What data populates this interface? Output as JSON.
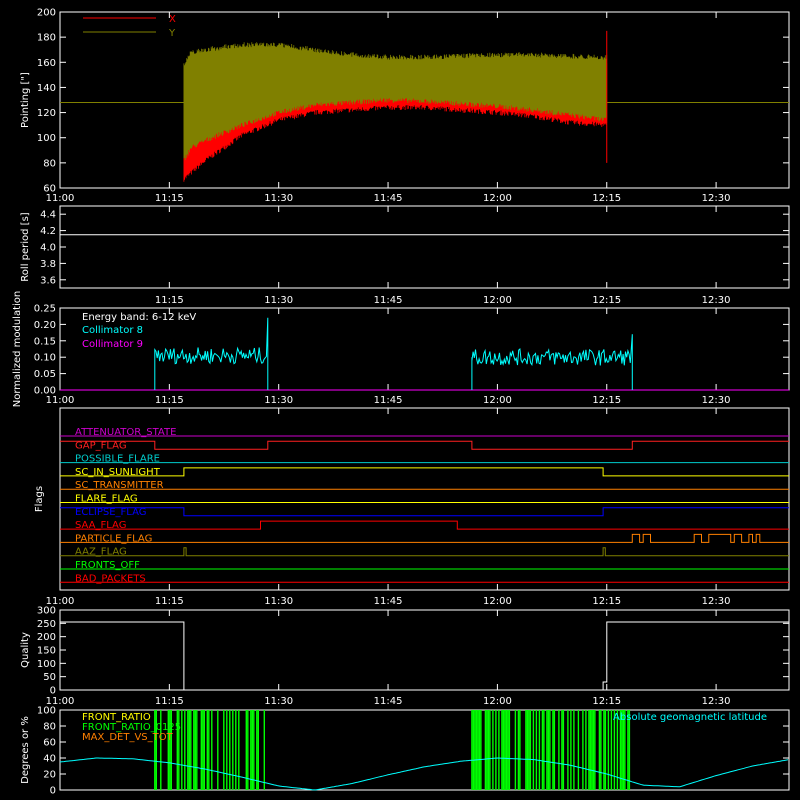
{
  "chart_data": [
    {
      "id": "pointing",
      "type": "line",
      "ylabel": "Pointing [\"]",
      "ylim": [
        60,
        200
      ],
      "yticks": [
        60,
        80,
        100,
        120,
        140,
        160,
        180,
        200
      ],
      "xticks": [
        "11:00",
        "11:15",
        "11:30",
        "11:45",
        "12:00",
        "12:15",
        "12:30"
      ],
      "x_range_minutes": [
        0,
        100
      ],
      "legend": [
        {
          "name": "X",
          "color": "#ff0000"
        },
        {
          "name": "Y",
          "color": "#808000"
        }
      ],
      "baseline_value": 128,
      "active_interval": [
        "11:17",
        "12:15"
      ],
      "series": [
        {
          "name": "X",
          "color": "#ff0000",
          "x": [
            17,
            18,
            20,
            25,
            30,
            35,
            40,
            45,
            50,
            55,
            60,
            65,
            70,
            75
          ],
          "low": [
            65,
            70,
            80,
            100,
            112,
            118,
            120,
            122,
            122,
            120,
            118,
            115,
            110,
            108
          ],
          "high": [
            145,
            150,
            155,
            160,
            160,
            158,
            158,
            160,
            162,
            164,
            164,
            164,
            163,
            162
          ]
        },
        {
          "name": "Y",
          "color": "#808000",
          "x": [
            17,
            18,
            20,
            25,
            30,
            35,
            40,
            45,
            50,
            55,
            60,
            65,
            70,
            75
          ],
          "low": [
            80,
            90,
            96,
            108,
            118,
            124,
            126,
            128,
            127,
            125,
            123,
            120,
            116,
            112
          ],
          "high": [
            160,
            170,
            172,
            176,
            176,
            172,
            168,
            166,
            166,
            167,
            168,
            168,
            167,
            166
          ]
        }
      ]
    },
    {
      "id": "roll",
      "type": "line",
      "ylabel": "Roll period [s]",
      "ylim": [
        3.5,
        4.5
      ],
      "yticks": [
        3.6,
        3.8,
        4.0,
        4.2,
        4.4
      ],
      "xticks": [
        "11:15",
        "11:30",
        "11:45",
        "12:00",
        "12:15",
        "12:30"
      ],
      "series": [
        {
          "name": "roll",
          "color": "#ffffff",
          "x": [
            0,
            100
          ],
          "values": [
            4.15,
            4.15
          ]
        }
      ]
    },
    {
      "id": "modulation",
      "type": "line",
      "ylabel": "Normalized modulation",
      "ylim": [
        0,
        0.25
      ],
      "yticks": [
        0.0,
        0.05,
        0.1,
        0.15,
        0.2,
        0.25
      ],
      "xticks": [
        "11:00",
        "11:15",
        "11:30",
        "11:45",
        "12:00",
        "12:15",
        "12:30"
      ],
      "legend": [
        {
          "name": "Energy band: 6-12 keV",
          "color": "#ffffff"
        },
        {
          "name": "Collimator 8",
          "color": "#00ffff"
        },
        {
          "name": "Collimator 9",
          "color": "#ff00ff"
        }
      ],
      "segments": [
        {
          "color": "#00ffff",
          "start": 13,
          "end": 28.5,
          "mean": 0.105,
          "spike": 0.22
        },
        {
          "color": "#00ffff",
          "start": 56.5,
          "end": 78.5,
          "mean": 0.1,
          "spike": 0.17
        }
      ],
      "baseline_color": "#ff00ff"
    },
    {
      "id": "flags",
      "type": "line",
      "ylabel": "Flags",
      "xticks": [
        "11:00",
        "11:15",
        "11:30",
        "11:45",
        "12:00",
        "12:15",
        "12:30"
      ],
      "flags": [
        {
          "name": "ATTENUATOR_STATE",
          "color": "#cc00cc",
          "changes": [
            [
              0,
              0
            ]
          ]
        },
        {
          "name": "GAP_FLAG",
          "color": "#ff2020",
          "changes": [
            [
              0,
              1
            ],
            [
              13,
              0
            ],
            [
              28.5,
              1
            ],
            [
              56.5,
              0
            ],
            [
              78.5,
              1
            ]
          ]
        },
        {
          "name": "POSSIBLE_FLARE",
          "color": "#00cccc",
          "changes": [
            [
              0,
              0
            ]
          ]
        },
        {
          "name": "SC_IN_SUNLIGHT",
          "color": "#ffff00",
          "changes": [
            [
              0,
              0
            ],
            [
              17,
              1
            ],
            [
              74.5,
              0
            ]
          ]
        },
        {
          "name": "SC_TRANSMITTER",
          "color": "#ff8000",
          "changes": [
            [
              0,
              0
            ]
          ]
        },
        {
          "name": "FLARE_FLAG",
          "color": "#ffff00",
          "changes": [
            [
              0,
              0
            ]
          ]
        },
        {
          "name": "ECLIPSE_FLAG",
          "color": "#0000ff",
          "changes": [
            [
              0,
              1
            ],
            [
              17,
              0
            ],
            [
              74.5,
              1
            ]
          ]
        },
        {
          "name": "SAA_FLAG",
          "color": "#ff0000",
          "changes": [
            [
              0,
              0
            ],
            [
              27.5,
              1
            ],
            [
              54.5,
              0
            ]
          ]
        },
        {
          "name": "PARTICLE_FLAG",
          "color": "#ff8000",
          "changes": [
            [
              0,
              0
            ],
            [
              78.5,
              1
            ],
            [
              79.5,
              0
            ],
            [
              80,
              1
            ],
            [
              81,
              0
            ],
            [
              87,
              1
            ],
            [
              88,
              0
            ],
            [
              89,
              1
            ],
            [
              92,
              0
            ],
            [
              92.5,
              1
            ],
            [
              93.5,
              0
            ],
            [
              94.5,
              1
            ],
            [
              95,
              0
            ],
            [
              95.5,
              1
            ],
            [
              96,
              0
            ]
          ]
        },
        {
          "name": "AAZ_FLAG",
          "color": "#808000",
          "changes": [
            [
              0,
              0
            ],
            [
              17,
              1
            ],
            [
              17.3,
              0
            ],
            [
              74.5,
              1
            ],
            [
              74.8,
              0
            ]
          ]
        },
        {
          "name": "FRONTS_OFF",
          "color": "#00ff00",
          "changes": [
            [
              0,
              0
            ]
          ]
        },
        {
          "name": "BAD_PACKETS",
          "color": "#ff0000",
          "changes": [
            [
              0,
              0
            ]
          ]
        }
      ]
    },
    {
      "id": "quality",
      "type": "line",
      "ylabel": "Quality",
      "ylim": [
        0,
        300
      ],
      "yticks": [
        0,
        50,
        100,
        150,
        200,
        250,
        300
      ],
      "xticks": [
        "11:00",
        "11:15",
        "11:30",
        "11:45",
        "12:00",
        "12:15",
        "12:30"
      ],
      "series": [
        {
          "name": "quality",
          "color": "#ffffff",
          "x": [
            0,
            17,
            17,
            74.5,
            74.5,
            75,
            75,
            100
          ],
          "values": [
            255,
            255,
            0,
            0,
            30,
            30,
            255,
            255
          ]
        }
      ]
    },
    {
      "id": "ratios",
      "type": "line",
      "ylabel": "Degrees or %",
      "ylim": [
        0,
        100
      ],
      "yticks": [
        0,
        20,
        40,
        60,
        80,
        100
      ],
      "legend": [
        {
          "name": "FRONT_RATIO",
          "color": "#ffff00"
        },
        {
          "name": "FRONT_RATIO_0125",
          "color": "#00ff00"
        },
        {
          "name": "MAX_DET_VS_TOT",
          "color": "#ff8000"
        }
      ],
      "right_legend": {
        "name": "Absolute geomagnetic latitude",
        "color": "#00ffff"
      },
      "bursts": [
        {
          "color": "#00ff00",
          "start": 13,
          "end": 28.5
        },
        {
          "color": "#00ff00",
          "start": 56.5,
          "end": 78.5
        }
      ],
      "latitude": {
        "color": "#00ffff",
        "x": [
          0,
          5,
          10,
          15,
          20,
          25,
          30,
          35,
          40,
          45,
          50,
          55,
          60,
          65,
          70,
          75,
          80,
          85,
          90,
          95,
          100
        ],
        "values": [
          35,
          40,
          39,
          34,
          26,
          16,
          5,
          0,
          8,
          19,
          29,
          36,
          40,
          38,
          31,
          20,
          6,
          4,
          18,
          30,
          38
        ]
      }
    }
  ]
}
